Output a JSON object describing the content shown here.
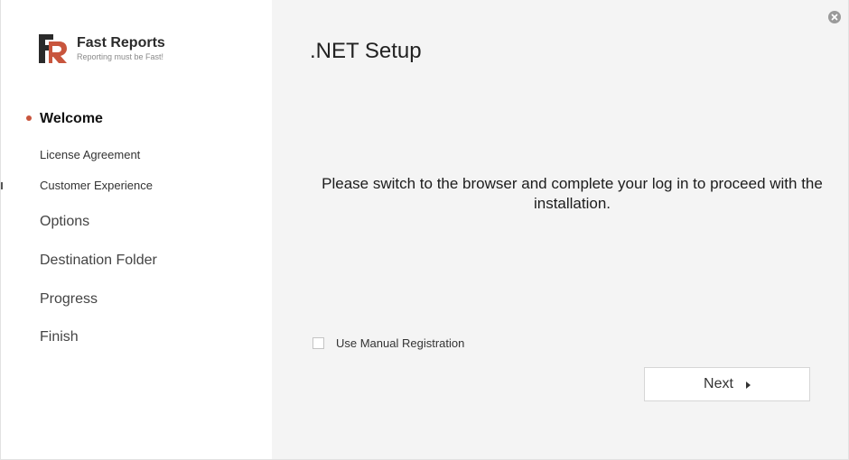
{
  "brand": {
    "name": "Fast Reports",
    "tagline": "Reporting must be Fast!",
    "accent_color": "#c8553d",
    "logo_icon": "fast-reports-logo-icon"
  },
  "sidebar": {
    "steps": [
      {
        "label": "Welcome",
        "active": true
      },
      {
        "label": "License Agreement",
        "active": false
      },
      {
        "label": "Customer Experience",
        "active": false
      },
      {
        "label": "Options",
        "active": false
      },
      {
        "label": "Destination Folder",
        "active": false
      },
      {
        "label": "Progress",
        "active": false
      },
      {
        "label": "Finish",
        "active": false
      }
    ]
  },
  "main": {
    "title": ".NET Setup",
    "message": "Please switch to the browser and complete your log in to proceed with the installation.",
    "checkbox": {
      "label": "Use Manual Registration",
      "checked": false
    },
    "next_button": {
      "label": "Next",
      "icon": "triangle-right-icon"
    },
    "close_icon": "close-icon"
  }
}
